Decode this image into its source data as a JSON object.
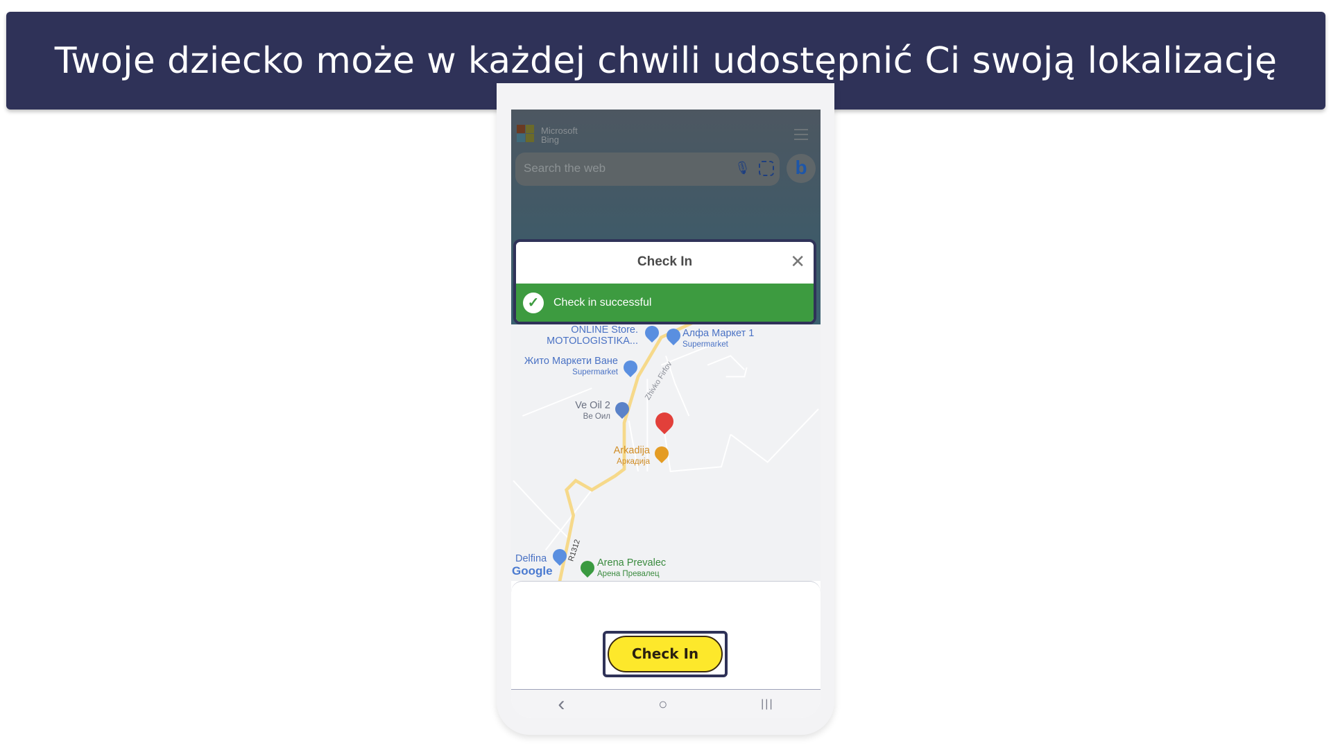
{
  "banner": {
    "title": "Twoje dziecko może w każdej chwili udostępnić Ci swoją lokalizację"
  },
  "bing": {
    "logo_line1": "Microsoft",
    "logo_line2": "Bing",
    "search_placeholder": "Search the web",
    "chat_glyph": "b"
  },
  "dialog": {
    "title": "Check In",
    "close": "✕",
    "status": "Check in successful",
    "status_color": "#3d9b40"
  },
  "map": {
    "places": [
      {
        "name": "ONLINE Store.",
        "sub": "MOTOLOGISTIKA..."
      },
      {
        "name": "Алфа Маркет 1",
        "sub": "Supermarket"
      },
      {
        "name": "Жито Маркети Ване",
        "sub": "Supermarket"
      },
      {
        "name": "Ve Oil 2",
        "sub": "Ве Оил"
      },
      {
        "name": "Arkadija",
        "sub": "Аркадија"
      },
      {
        "name": "Delfina"
      },
      {
        "name": "Arena Prevalec",
        "sub": "Арена Превалец"
      }
    ],
    "street": "Zhivko Firfov",
    "road": "R1312",
    "provider": "Google"
  },
  "checkin": {
    "label": "Check In",
    "color": "#fde82b"
  },
  "nav": {
    "back": "‹",
    "home": "○",
    "recents": "|||"
  }
}
